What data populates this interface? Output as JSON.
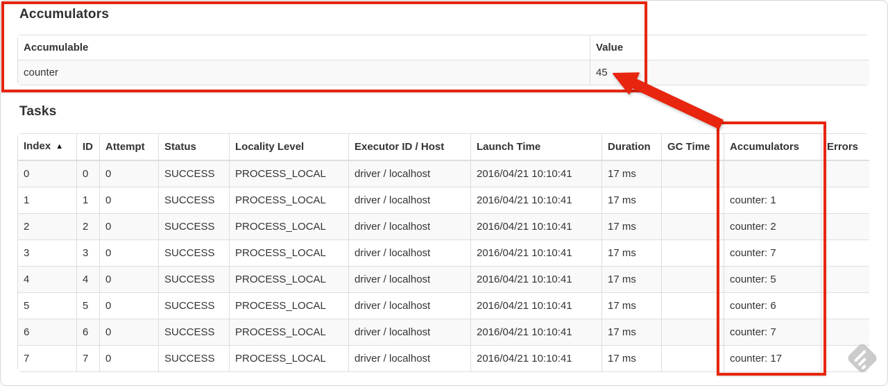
{
  "colors": {
    "annotation_red": "#e8250e",
    "table_border": "#dddddd",
    "row_stripe": "#f9f9f9",
    "text_color": "#333333",
    "watermark_gray": "#c7c7c7"
  },
  "accumulators_section": {
    "heading": "Accumulators",
    "table": {
      "headers": [
        "Accumulable",
        "Value"
      ],
      "rows": [
        [
          "counter",
          "45"
        ]
      ]
    }
  },
  "tasks_section": {
    "heading": "Tasks",
    "table": {
      "headers": [
        "Index",
        "ID",
        "Attempt",
        "Status",
        "Locality Level",
        "Executor ID / Host",
        "Launch Time",
        "Duration",
        "GC Time",
        "Accumulators",
        "Errors"
      ],
      "sort_indicator": "▲",
      "rows": [
        [
          "0",
          "0",
          "0",
          "SUCCESS",
          "PROCESS_LOCAL",
          "driver / localhost",
          "2016/04/21 10:10:41",
          "17 ms",
          "",
          "",
          ""
        ],
        [
          "1",
          "1",
          "0",
          "SUCCESS",
          "PROCESS_LOCAL",
          "driver / localhost",
          "2016/04/21 10:10:41",
          "17 ms",
          "",
          "counter: 1",
          ""
        ],
        [
          "2",
          "2",
          "0",
          "SUCCESS",
          "PROCESS_LOCAL",
          "driver / localhost",
          "2016/04/21 10:10:41",
          "17 ms",
          "",
          "counter: 2",
          ""
        ],
        [
          "3",
          "3",
          "0",
          "SUCCESS",
          "PROCESS_LOCAL",
          "driver / localhost",
          "2016/04/21 10:10:41",
          "17 ms",
          "",
          "counter: 7",
          ""
        ],
        [
          "4",
          "4",
          "0",
          "SUCCESS",
          "PROCESS_LOCAL",
          "driver / localhost",
          "2016/04/21 10:10:41",
          "17 ms",
          "",
          "counter: 5",
          ""
        ],
        [
          "5",
          "5",
          "0",
          "SUCCESS",
          "PROCESS_LOCAL",
          "driver / localhost",
          "2016/04/21 10:10:41",
          "17 ms",
          "",
          "counter: 6",
          ""
        ],
        [
          "6",
          "6",
          "0",
          "SUCCESS",
          "PROCESS_LOCAL",
          "driver / localhost",
          "2016/04/21 10:10:41",
          "17 ms",
          "",
          "counter: 7",
          ""
        ],
        [
          "7",
          "7",
          "0",
          "SUCCESS",
          "PROCESS_LOCAL",
          "driver / localhost",
          "2016/04/21 10:10:41",
          "17 ms",
          "",
          "counter: 17",
          ""
        ]
      ]
    }
  }
}
